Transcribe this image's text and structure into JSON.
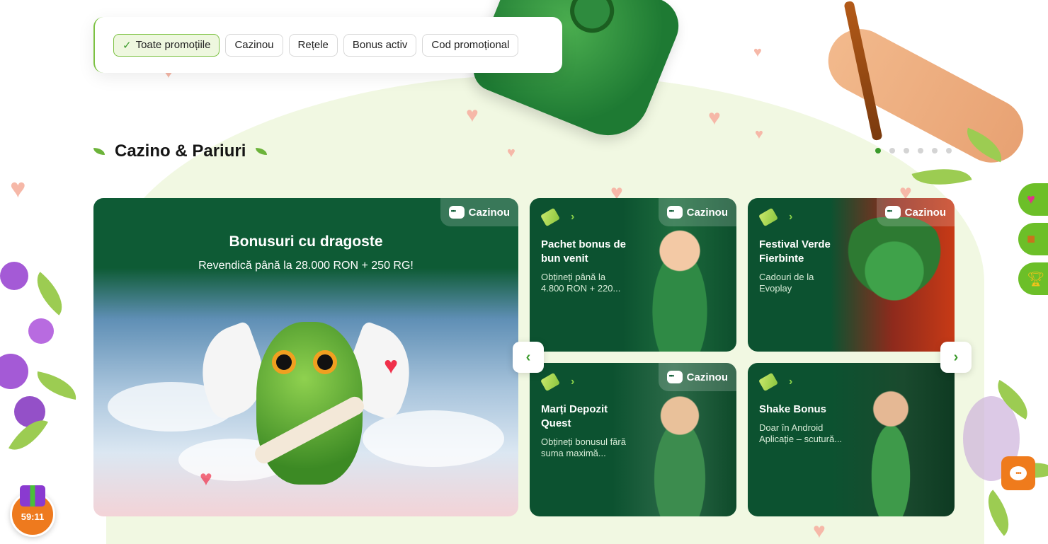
{
  "filters": {
    "items": [
      {
        "label": "Toate promoțiile",
        "active": true
      },
      {
        "label": "Cazinou",
        "active": false
      },
      {
        "label": "Rețele",
        "active": false
      },
      {
        "label": "Bonus activ",
        "active": false
      },
      {
        "label": "Cod promoțional",
        "active": false
      }
    ]
  },
  "section": {
    "title": "Cazino & Pariuri",
    "pager_total": 6,
    "pager_active": 1
  },
  "cards": {
    "featured": {
      "badge": "Cazinou",
      "title": "Bonusuri cu dragoste",
      "subtitle": "Revendică până la 28.000 RON + 250 RG!"
    },
    "small": [
      {
        "badge": "Cazinou",
        "title": "Pachet bonus de bun venit",
        "desc": "Obțineți până la 4.800 RON + 220..."
      },
      {
        "badge": "Cazinou",
        "title": "Festival Verde Fierbinte",
        "desc": "Cadouri de la Evoplay"
      },
      {
        "badge": "Cazinou",
        "title": "Marți Depozit Quest",
        "desc": "Obțineți bonusul fără suma maximă..."
      },
      {
        "badge": "",
        "title": "Shake Bonus",
        "desc": "Doar în Android Aplicație – scutură..."
      }
    ]
  },
  "timer": {
    "value": "59:11"
  },
  "colors": {
    "accent": "#3a9a2a",
    "card_bg": "#0d5a34",
    "orange": "#ef7b1c",
    "side_green": "#6cbf28"
  },
  "icons": {
    "check": "check-icon",
    "chevron_left": "chevron-left-icon",
    "chevron_right": "chevron-right-icon",
    "chat": "chat-icon",
    "gift": "gift-icon"
  }
}
